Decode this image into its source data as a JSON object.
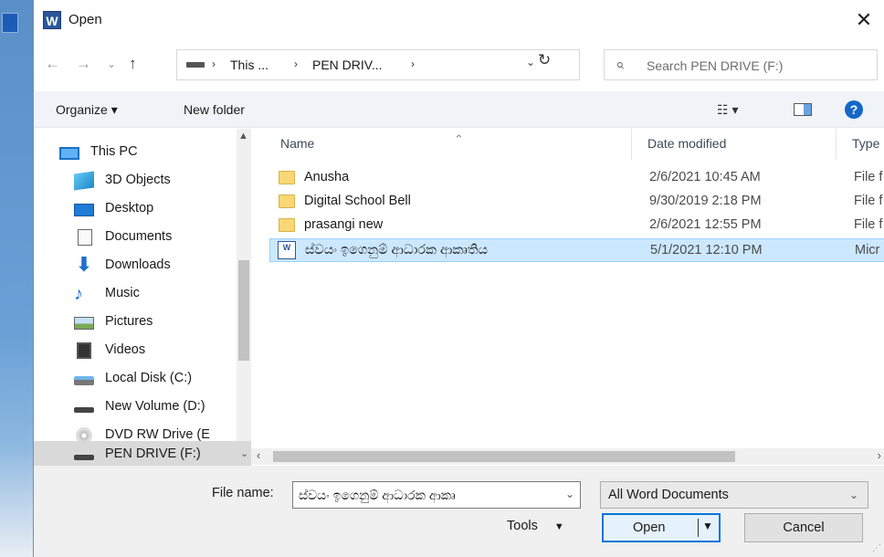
{
  "window": {
    "app_icon_letter": "W",
    "title": "Open",
    "close_glyph": "✕"
  },
  "nav": {
    "back": "←",
    "forward": "→",
    "recent": "⌄",
    "up": "↑",
    "breadcrumbs": [
      "This ...",
      "PEN DRIV..."
    ],
    "separator": "›",
    "refresh": "↻",
    "search_placeholder": "Search PEN DRIVE (F:)"
  },
  "toolbar": {
    "organize": "Organize ▾",
    "new_folder": "New folder",
    "view_glyph": "☷ ▾",
    "help": "?"
  },
  "sidebar": {
    "items": [
      {
        "label": "This PC",
        "icon": "this-pc-icon"
      },
      {
        "label": "3D Objects",
        "icon": "3d-objects-icon"
      },
      {
        "label": "Desktop",
        "icon": "desktop-icon"
      },
      {
        "label": "Documents",
        "icon": "documents-icon"
      },
      {
        "label": "Downloads",
        "icon": "downloads-icon"
      },
      {
        "label": "Music",
        "icon": "music-icon"
      },
      {
        "label": "Pictures",
        "icon": "pictures-icon"
      },
      {
        "label": "Videos",
        "icon": "videos-icon"
      },
      {
        "label": "Local Disk (C:)",
        "icon": "local-disk-icon"
      },
      {
        "label": "New Volume (D:)",
        "icon": "drive-icon"
      },
      {
        "label": "DVD RW Drive (E",
        "icon": "dvd-icon"
      },
      {
        "label": "PEN DRIVE (F:)",
        "icon": "usb-drive-icon"
      }
    ]
  },
  "files": {
    "columns": {
      "name": "Name",
      "date": "Date modified",
      "type": "Type"
    },
    "rows": [
      {
        "name": "Anusha",
        "date": "2/6/2021 10:45 AM",
        "type": "File f",
        "kind": "folder"
      },
      {
        "name": "Digital School Bell",
        "date": "9/30/2019 2:18 PM",
        "type": "File f",
        "kind": "folder"
      },
      {
        "name": "prasangi new",
        "date": "2/6/2021 12:55 PM",
        "type": "File f",
        "kind": "folder"
      },
      {
        "name": "ස්වයං ඉගෙනුම් ආධාරක ආකෘතිය",
        "date": "5/1/2021 12:10 PM",
        "type": "Micr",
        "kind": "word-doc",
        "selected": true
      }
    ]
  },
  "bottom": {
    "file_name_label": "File name:",
    "file_name_value": "ස්වයං ඉගෙනුම් ආධාරක ආකෘ",
    "filter_value": "All Word Documents",
    "tools_label": "Tools",
    "open_label": "Open",
    "cancel_label": "Cancel"
  },
  "colors": {
    "selection": "#cce8ff",
    "accent": "#0078d7",
    "folder": "#f8d775"
  }
}
